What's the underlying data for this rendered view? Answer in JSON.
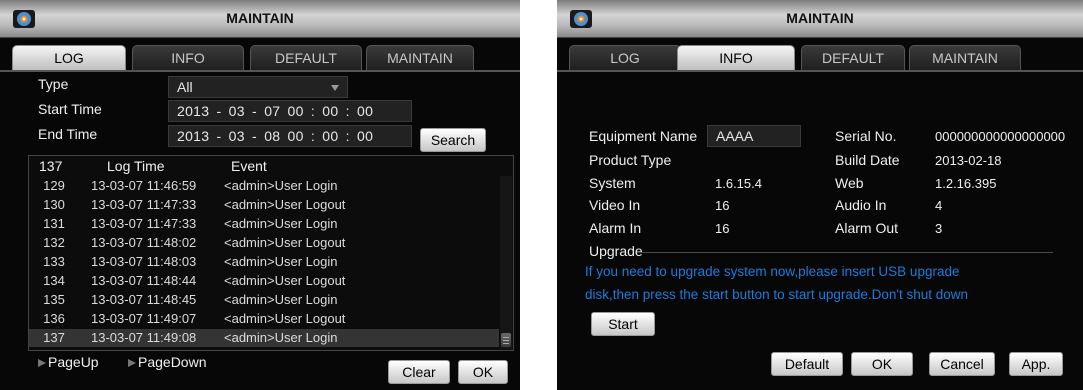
{
  "left": {
    "title": "MAINTAIN",
    "tabs": [
      "LOG",
      "INFO",
      "DEFAULT",
      "MAINTAIN"
    ],
    "active_tab": "LOG",
    "type_label": "Type",
    "type_value": "All",
    "start_label": "Start Time",
    "start_value": "2013 - 03 - 07   00 : 00 : 00",
    "end_label": "End Time",
    "end_value": "2013 - 03 - 08   00 : 00 : 00",
    "search_button": "Search",
    "table": {
      "count": "137",
      "time_header": "Log Time",
      "event_header": "Event",
      "rows": [
        {
          "num": "129",
          "time": "13-03-07 11:46:59",
          "event": "<admin>User Login"
        },
        {
          "num": "130",
          "time": "13-03-07 11:47:33",
          "event": "<admin>User Logout"
        },
        {
          "num": "131",
          "time": "13-03-07 11:47:33",
          "event": "<admin>User Login"
        },
        {
          "num": "132",
          "time": "13-03-07 11:48:02",
          "event": "<admin>User Logout"
        },
        {
          "num": "133",
          "time": "13-03-07 11:48:03",
          "event": "<admin>User Login"
        },
        {
          "num": "134",
          "time": "13-03-07 11:48:44",
          "event": "<admin>User Logout"
        },
        {
          "num": "135",
          "time": "13-03-07 11:48:45",
          "event": "<admin>User Login"
        },
        {
          "num": "136",
          "time": "13-03-07 11:49:07",
          "event": "<admin>User Logout"
        },
        {
          "num": "137",
          "time": "13-03-07 11:49:08",
          "event": "<admin>User Login"
        }
      ]
    },
    "page_up": "PageUp",
    "page_down": "PageDown",
    "clear_button": "Clear",
    "ok_button": "OK"
  },
  "right": {
    "title": "MAINTAIN",
    "tabs": [
      "LOG",
      "INFO",
      "DEFAULT",
      "MAINTAIN"
    ],
    "active_tab": "INFO",
    "equipment_name_label": "Equipment Name",
    "equipment_name_value": "AAAA",
    "serial_label": "Serial No.",
    "serial_value": "000000000000000000",
    "product_type_label": "Product Type",
    "build_date_label": "Build Date",
    "build_date_value": "2013-02-18",
    "system_label": "System",
    "system_value": "1.6.15.4",
    "web_label": "Web",
    "web_value": "1.2.16.395",
    "video_in_label": "Video In",
    "video_in_value": "16",
    "audio_in_label": "Audio In",
    "audio_in_value": "4",
    "alarm_in_label": "Alarm In",
    "alarm_in_value": "16",
    "alarm_out_label": "Alarm Out",
    "alarm_out_value": "3",
    "upgrade_label": "Upgrade",
    "upgrade_line1": "If you need to upgrade system now,please insert USB upgrade",
    "upgrade_line2": "disk,then press the start button to start upgrade.Don't shut down",
    "start_button": "Start",
    "default_button": "Default",
    "ok_button": "OK",
    "cancel_button": "Cancel",
    "app_button": "App."
  },
  "colors": {
    "background": "#070707",
    "title_bar": "#c8c8c8",
    "upgrade_text": "#1e7bdc",
    "selected_row": "#343434"
  },
  "icons": [
    "camera-logo-icon",
    "dropdown-arrow-icon",
    "page-up-icon",
    "page-down-icon"
  ]
}
